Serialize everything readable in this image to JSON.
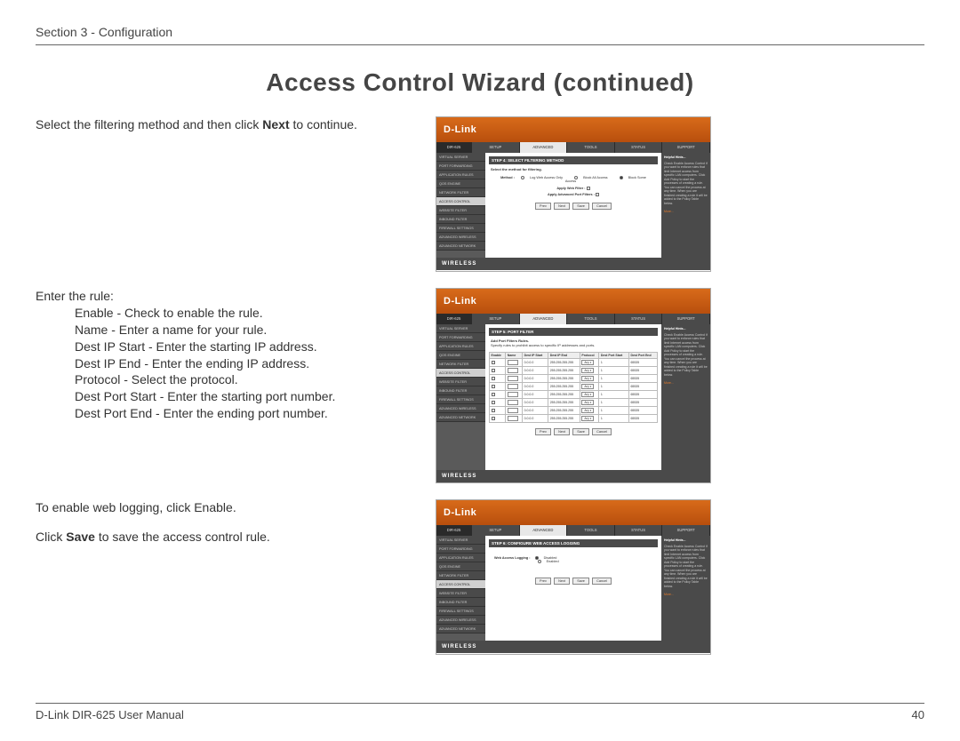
{
  "header": {
    "section": "Section 3 - Configuration"
  },
  "title": "Access Control Wizard (continued)",
  "para1_pre": "Select the filtering method and then click ",
  "para1_bold": "Next",
  "para1_post": " to continue.",
  "rule_intro": "Enter the rule:",
  "rules": {
    "enable": "Enable - Check to enable the rule.",
    "name": "Name - Enter a name for your rule.",
    "ip_start": "Dest IP Start - Enter the starting IP address.",
    "ip_end": "Dest IP End - Enter the ending IP address.",
    "protocol": "Protocol - Select the protocol.",
    "port_start": "Dest Port Start - Enter the starting port number.",
    "port_end": "Dest Port End - Enter the ending port number."
  },
  "para3a": "To enable web logging, click Enable.",
  "para3b_pre": "Click ",
  "para3b_bold": "Save",
  "para3b_post": " to save the access control rule.",
  "footer": {
    "left": "D-Link DIR-625 User Manual",
    "page": "40"
  },
  "shot_common": {
    "brand": "D-Link",
    "model": "DIR-625",
    "tabs": [
      "SETUP",
      "ADVANCED",
      "TOOLS",
      "STATUS",
      "SUPPORT"
    ],
    "sidebar": [
      "VIRTUAL SERVER",
      "PORT FORWARDING",
      "APPLICATION RULES",
      "QOS ENGINE",
      "NETWORK FILTER",
      "ACCESS CONTROL",
      "WEBSITE FILTER",
      "INBOUND FILTER",
      "FIREWALL SETTINGS",
      "ADVANCED WIRELESS",
      "ADVANCED NETWORK"
    ],
    "help_title": "Helpful Hints...",
    "help_body": "Check Enable Access Control if you want to enforce rules that limit Internet access from specific LAN computers. Click Add Policy to start the processes of creating a rule. You can cancel the process at any time. When you are finished creating a rule it will be added to the Policy Table below.",
    "help_more": "More...",
    "buttons": {
      "prev": "Prev",
      "next": "Next",
      "save": "Save",
      "cancel": "Cancel"
    },
    "footer": "WIRELESS"
  },
  "shot1": {
    "step_title": "STEP 4: SELECT FILTERING METHOD",
    "subtitle": "Select the method for filtering.",
    "method_label": "Method :",
    "methods": [
      "Log Web Access Only",
      "Block All Access",
      "Block Some Access"
    ],
    "apply_web": "Apply Web Filter :",
    "apply_port": "Apply Advanced Port Filters :"
  },
  "shot2": {
    "step_title": "STEP 5: PORT FILTER",
    "subtitle": "Add Port Filters Rules.",
    "desc": "Specify rules to prohibit access to specific IP addresses and ports.",
    "cols": [
      "Enable",
      "Name",
      "Dest IP Start",
      "Dest IP End",
      "Protocol",
      "Dest Port Start",
      "Dest Port End"
    ],
    "row": {
      "ip_start": "0.0.0.0",
      "ip_end": "255.255.255.255",
      "proto": "Any",
      "pstart": "1",
      "pend": "65535"
    },
    "row_count": 8
  },
  "shot3": {
    "step_title": "STEP 6: CONFIGURE WEB ACCESS LOGGING",
    "label": "Web Access Logging :",
    "opts": [
      "Disabled",
      "Enabled"
    ]
  }
}
